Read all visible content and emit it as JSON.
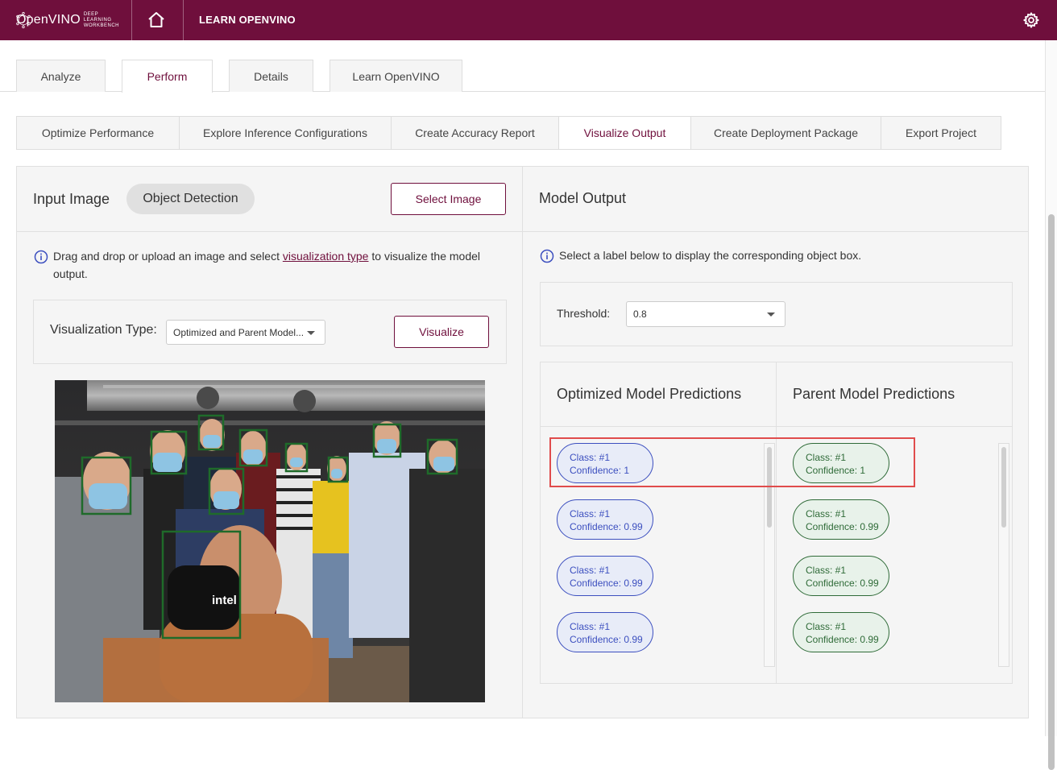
{
  "header": {
    "brand": "OpenVINO",
    "brand_sub": "DEEP LEARNING WORKBENCH",
    "nav_label": "LEARN OPENVINO"
  },
  "main_tabs": [
    {
      "label": "Analyze"
    },
    {
      "label": "Perform"
    },
    {
      "label": "Details"
    },
    {
      "label": "Learn OpenVINO"
    }
  ],
  "sub_tabs": [
    {
      "label": "Optimize Performance"
    },
    {
      "label": "Explore Inference Configurations"
    },
    {
      "label": "Create Accuracy Report"
    },
    {
      "label": "Visualize Output"
    },
    {
      "label": "Create Deployment Package"
    },
    {
      "label": "Export Project"
    }
  ],
  "left_panel": {
    "title": "Input Image",
    "chip": "Object Detection",
    "select_image": "Select Image",
    "info_prefix": "Drag and drop or upload an image and select ",
    "info_link": "visualization type",
    "info_suffix": " to visualize the model output.",
    "vis_type_label": "Visualization Type:",
    "vis_type_value": "Optimized and Parent Model...",
    "visualize_button": "Visualize"
  },
  "right_panel": {
    "title": "Model Output",
    "info": "Select a label below to display the corresponding object box.",
    "threshold_label": "Threshold:",
    "threshold_value": "0.8",
    "optimized_title": "Optimized Model Predictions",
    "parent_title": "Parent Model Predictions",
    "optimized_predictions": [
      {
        "class": "Class: #1",
        "confidence": "Confidence: 1"
      },
      {
        "class": "Class: #1",
        "confidence": "Confidence: 0.99"
      },
      {
        "class": "Class: #1",
        "confidence": "Confidence: 0.99"
      },
      {
        "class": "Class: #1",
        "confidence": "Confidence: 0.99"
      }
    ],
    "parent_predictions": [
      {
        "class": "Class: #1",
        "confidence": "Confidence: 1"
      },
      {
        "class": "Class: #1",
        "confidence": "Confidence: 0.99"
      },
      {
        "class": "Class: #1",
        "confidence": "Confidence: 0.99"
      },
      {
        "class": "Class: #1",
        "confidence": "Confidence: 0.99"
      }
    ]
  },
  "photo": {
    "mask_text": "intel"
  },
  "colors": {
    "brand": "#6f0f3c",
    "optimized": "#3c4fbf",
    "parent": "#2f6b38",
    "detection_box": "#1f6b2a",
    "highlight": "#e04c4c"
  }
}
